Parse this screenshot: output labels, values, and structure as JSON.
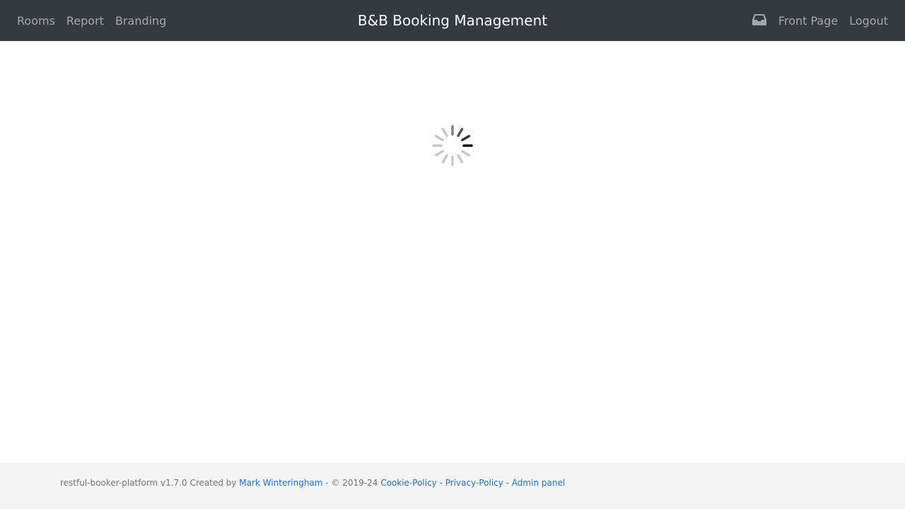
{
  "navbar": {
    "left_links": [
      "Rooms",
      "Report",
      "Branding"
    ],
    "brand": "B&B Booking Management",
    "inbox_icon": "inbox-icon",
    "right_links": [
      "Front Page",
      "Logout"
    ]
  },
  "loading": {
    "icon": "loading-spinner-icon"
  },
  "footer": {
    "prefix": "restful-booker-platform v1.7.0 Created by ",
    "author_link": "Mark Winteringham",
    "sep1": " - © 2019-24 ",
    "cookie_link": "Cookie-Policy",
    "sep2": " - ",
    "privacy_link": "Privacy-Policy",
    "sep3": " - ",
    "admin_link": "Admin panel"
  },
  "colors": {
    "navbar_bg": "#343a40",
    "footer_bg": "#f4f4f4",
    "link": "#1e6fd9"
  }
}
